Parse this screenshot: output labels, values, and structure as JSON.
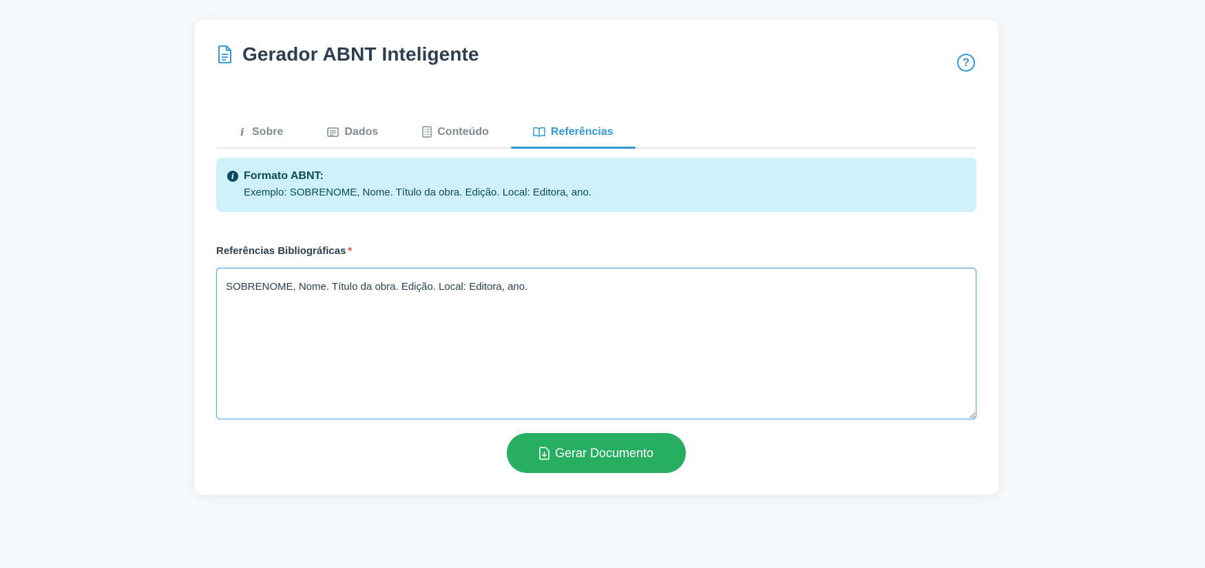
{
  "app": {
    "title": "Gerador ABNT Inteligente",
    "help_label": "?"
  },
  "tabs": [
    {
      "label": "Sobre",
      "icon": "info-icon",
      "active": false
    },
    {
      "label": "Dados",
      "icon": "card-icon",
      "active": false
    },
    {
      "label": "Conteúdo",
      "icon": "document-list-icon",
      "active": false
    },
    {
      "label": "Referências",
      "icon": "book-icon",
      "active": true
    }
  ],
  "alert": {
    "title": "Formato ABNT:",
    "text": "Exemplo: SOBRENOME, Nome. Título da obra. Edição. Local: Editora, ano."
  },
  "references_field": {
    "label": "Referências Bibliográficas",
    "required_mark": "*",
    "value": "SOBRENOME, Nome. Título da obra. Edição. Local: Editora, ano."
  },
  "generate_button": {
    "label": "Gerar Documento"
  },
  "colors": {
    "accent": "#3498db",
    "success": "#27ae60",
    "alert_bg": "#cff2f9",
    "required": "#e74c3c"
  }
}
